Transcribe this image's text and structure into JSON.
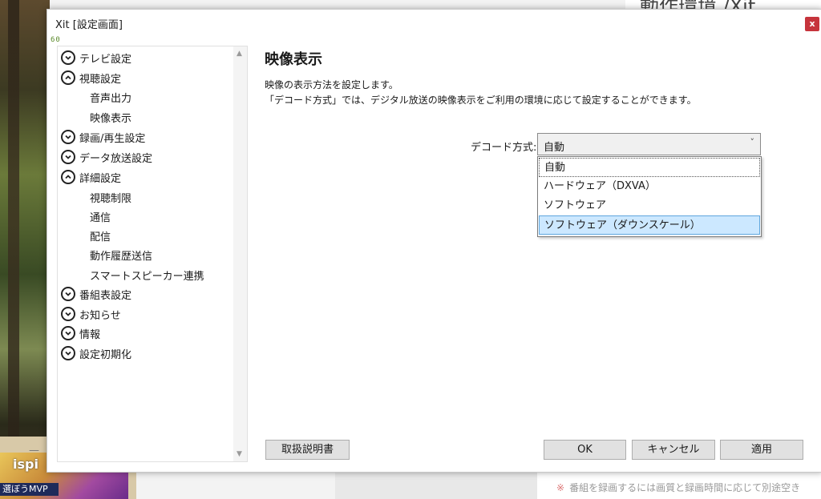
{
  "background": {
    "thumbnail_caption": "選ぼうMVP",
    "thumbnail_brand": "ispi",
    "note": "番組を録画するには画質と録画時間に応じて別途空き",
    "note_mark": "※",
    "top_heading": "動作環境 /Xit",
    "dash": "—"
  },
  "dialog": {
    "title": "Xit [設定画面]",
    "close_label": "x",
    "fps": "60"
  },
  "nav": {
    "items": [
      {
        "label": "テレビ設定",
        "expanded": false
      },
      {
        "label": "視聴設定",
        "expanded": true
      },
      {
        "label": "音声出力"
      },
      {
        "label": "映像表示"
      },
      {
        "label": "録画/再生設定",
        "expanded": false
      },
      {
        "label": "データ放送設定",
        "expanded": false
      },
      {
        "label": "詳細設定",
        "expanded": true
      },
      {
        "label": "視聴制限"
      },
      {
        "label": "通信"
      },
      {
        "label": "配信"
      },
      {
        "label": "動作履歴送信"
      },
      {
        "label": "スマートスピーカー連携"
      },
      {
        "label": "番組表設定",
        "expanded": false
      },
      {
        "label": "お知らせ",
        "expanded": false
      },
      {
        "label": "情報",
        "expanded": false
      },
      {
        "label": "設定初期化",
        "expanded": false
      }
    ]
  },
  "content": {
    "title": "映像表示",
    "desc1": "映像の表示方法を設定します。",
    "desc2": "「デコード方式」では、デジタル放送の映像表示をご利用の環境に応じて設定することができます。",
    "decode_label": "デコード方式:",
    "decode_value": "自動",
    "options": [
      "自動",
      "ハードウェア（DXVA）",
      "ソフトウェア",
      "ソフトウェア（ダウンスケール）"
    ]
  },
  "buttons": {
    "manual": "取扱説明書",
    "ok": "OK",
    "cancel": "キャンセル",
    "apply": "適用"
  },
  "colors": {
    "close_red": "#c6343c",
    "highlight": "#cce8ff"
  }
}
